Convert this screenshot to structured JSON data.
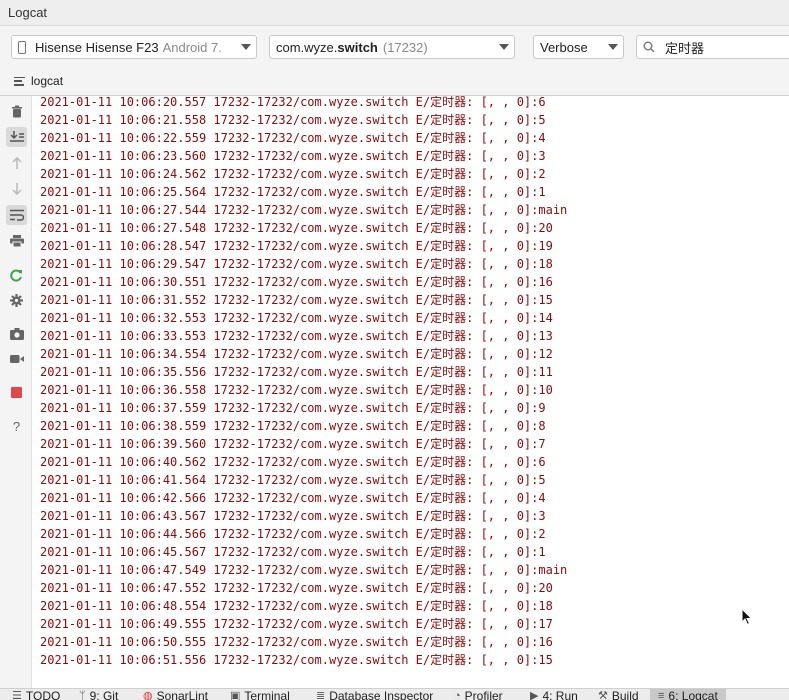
{
  "window": {
    "title": "Logcat"
  },
  "toolbar": {
    "device": {
      "name": "Hisense Hisense F23",
      "version": "Android 7."
    },
    "process": {
      "package_prefix": "com.wyze.",
      "package_bold": "switch",
      "pid": "(17232)"
    },
    "log_level": "Verbose",
    "search_value": "定时器"
  },
  "tabs": {
    "logcat": "logcat"
  },
  "colors": {
    "log_error": "#8b0a0a",
    "stop_button": "#e0474c",
    "rerun_icon": "#3ea34a"
  },
  "sidebar_icons": [
    "trash-icon",
    "scroll-to-end-icon",
    "up-arrow-icon",
    "down-arrow-icon",
    "soft-wrap-icon",
    "print-icon",
    "restart-icon",
    "settings-icon",
    "screenshot-icon",
    "screen-record-icon",
    "stop-icon",
    "help-icon"
  ],
  "log_lines": [
    "2021-01-11 10:06:20.557 17232-17232/com.wyze.switch E/定时器: [, , 0]:6",
    "2021-01-11 10:06:21.558 17232-17232/com.wyze.switch E/定时器: [, , 0]:5",
    "2021-01-11 10:06:22.559 17232-17232/com.wyze.switch E/定时器: [, , 0]:4",
    "2021-01-11 10:06:23.560 17232-17232/com.wyze.switch E/定时器: [, , 0]:3",
    "2021-01-11 10:06:24.562 17232-17232/com.wyze.switch E/定时器: [, , 0]:2",
    "2021-01-11 10:06:25.564 17232-17232/com.wyze.switch E/定时器: [, , 0]:1",
    "2021-01-11 10:06:27.544 17232-17232/com.wyze.switch E/定时器: [, , 0]:main",
    "2021-01-11 10:06:27.548 17232-17232/com.wyze.switch E/定时器: [, , 0]:20",
    "2021-01-11 10:06:28.547 17232-17232/com.wyze.switch E/定时器: [, , 0]:19",
    "2021-01-11 10:06:29.547 17232-17232/com.wyze.switch E/定时器: [, , 0]:18",
    "2021-01-11 10:06:30.551 17232-17232/com.wyze.switch E/定时器: [, , 0]:16",
    "2021-01-11 10:06:31.552 17232-17232/com.wyze.switch E/定时器: [, , 0]:15",
    "2021-01-11 10:06:32.553 17232-17232/com.wyze.switch E/定时器: [, , 0]:14",
    "2021-01-11 10:06:33.553 17232-17232/com.wyze.switch E/定时器: [, , 0]:13",
    "2021-01-11 10:06:34.554 17232-17232/com.wyze.switch E/定时器: [, , 0]:12",
    "2021-01-11 10:06:35.556 17232-17232/com.wyze.switch E/定时器: [, , 0]:11",
    "2021-01-11 10:06:36.558 17232-17232/com.wyze.switch E/定时器: [, , 0]:10",
    "2021-01-11 10:06:37.559 17232-17232/com.wyze.switch E/定时器: [, , 0]:9",
    "2021-01-11 10:06:38.559 17232-17232/com.wyze.switch E/定时器: [, , 0]:8",
    "2021-01-11 10:06:39.560 17232-17232/com.wyze.switch E/定时器: [, , 0]:7",
    "2021-01-11 10:06:40.562 17232-17232/com.wyze.switch E/定时器: [, , 0]:6",
    "2021-01-11 10:06:41.564 17232-17232/com.wyze.switch E/定时器: [, , 0]:5",
    "2021-01-11 10:06:42.566 17232-17232/com.wyze.switch E/定时器: [, , 0]:4",
    "2021-01-11 10:06:43.567 17232-17232/com.wyze.switch E/定时器: [, , 0]:3",
    "2021-01-11 10:06:44.566 17232-17232/com.wyze.switch E/定时器: [, , 0]:2",
    "2021-01-11 10:06:45.567 17232-17232/com.wyze.switch E/定时器: [, , 0]:1",
    "2021-01-11 10:06:47.549 17232-17232/com.wyze.switch E/定时器: [, , 0]:main",
    "2021-01-11 10:06:47.552 17232-17232/com.wyze.switch E/定时器: [, , 0]:20",
    "2021-01-11 10:06:48.554 17232-17232/com.wyze.switch E/定时器: [, , 0]:18",
    "2021-01-11 10:06:49.555 17232-17232/com.wyze.switch E/定时器: [, , 0]:17",
    "2021-01-11 10:06:50.555 17232-17232/com.wyze.switch E/定时器: [, , 0]:16",
    "2021-01-11 10:06:51.556 17232-17232/com.wyze.switch E/定时器: [, , 0]:15"
  ],
  "bottom_tabs": [
    {
      "icon": "list-icon",
      "label": "TODO",
      "active": false
    },
    {
      "icon": "git-icon",
      "label": "9: Git",
      "active": false
    },
    {
      "icon": "sonarlint-icon",
      "label": "SonarLint",
      "active": false
    },
    {
      "icon": "terminal-icon",
      "label": "Terminal",
      "active": false
    },
    {
      "icon": "database-icon",
      "label": "Database Inspector",
      "active": false
    },
    {
      "icon": "profiler-icon",
      "label": "Profiler",
      "active": false
    },
    {
      "icon": "run-icon",
      "label": "4: Run",
      "active": false
    },
    {
      "icon": "build-icon",
      "label": "Build",
      "active": false
    },
    {
      "icon": "logcat-icon",
      "label": "6: Logcat",
      "active": true
    }
  ]
}
